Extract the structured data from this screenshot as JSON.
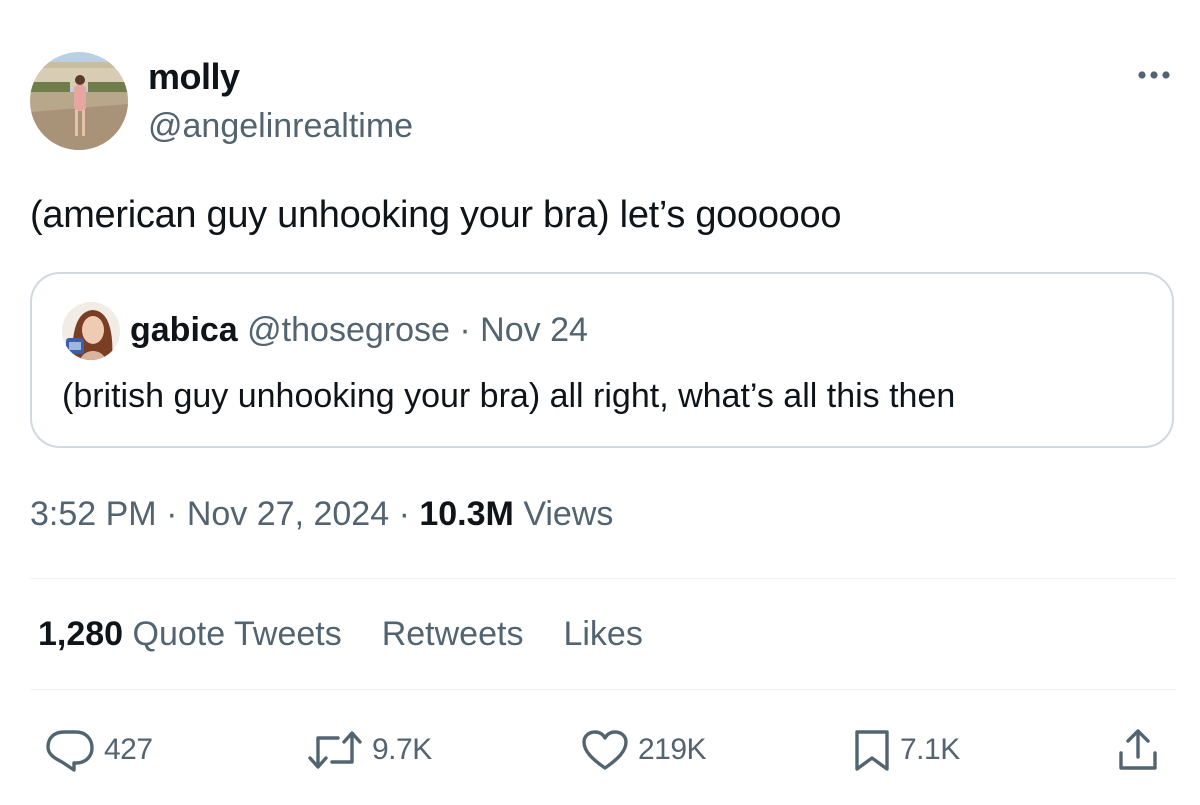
{
  "author": {
    "display_name": "molly",
    "handle": "@angelinrealtime"
  },
  "tweet": {
    "text": "(american guy unhooking your bra) let’s goooooo"
  },
  "quoted_tweet": {
    "display_name": "gabica",
    "handle": "@thosegrose",
    "separator": "·",
    "date": "Nov 24",
    "text": "(british guy unhooking your bra) all right, what’s all this then"
  },
  "meta": {
    "time": "3:52 PM",
    "separator": "·",
    "date": "Nov 27, 2024",
    "views_count": "10.3M",
    "views_label": "Views"
  },
  "stats": {
    "quote_count": "1,280",
    "quote_label": "Quote Tweets",
    "retweets_label": "Retweets",
    "likes_label": "Likes"
  },
  "actions": {
    "replies": "427",
    "retweets": "9.7K",
    "likes": "219K",
    "bookmarks": "7.1K"
  },
  "icons": {
    "more": "more-horizontal-icon",
    "reply": "reply-icon",
    "retweet": "retweet-icon",
    "like": "heart-icon",
    "bookmark": "bookmark-icon",
    "share": "share-icon"
  },
  "colors": {
    "text": "#0f1419",
    "secondary": "#536471",
    "border": "#cfd9de",
    "divider": "#eff3f4"
  }
}
